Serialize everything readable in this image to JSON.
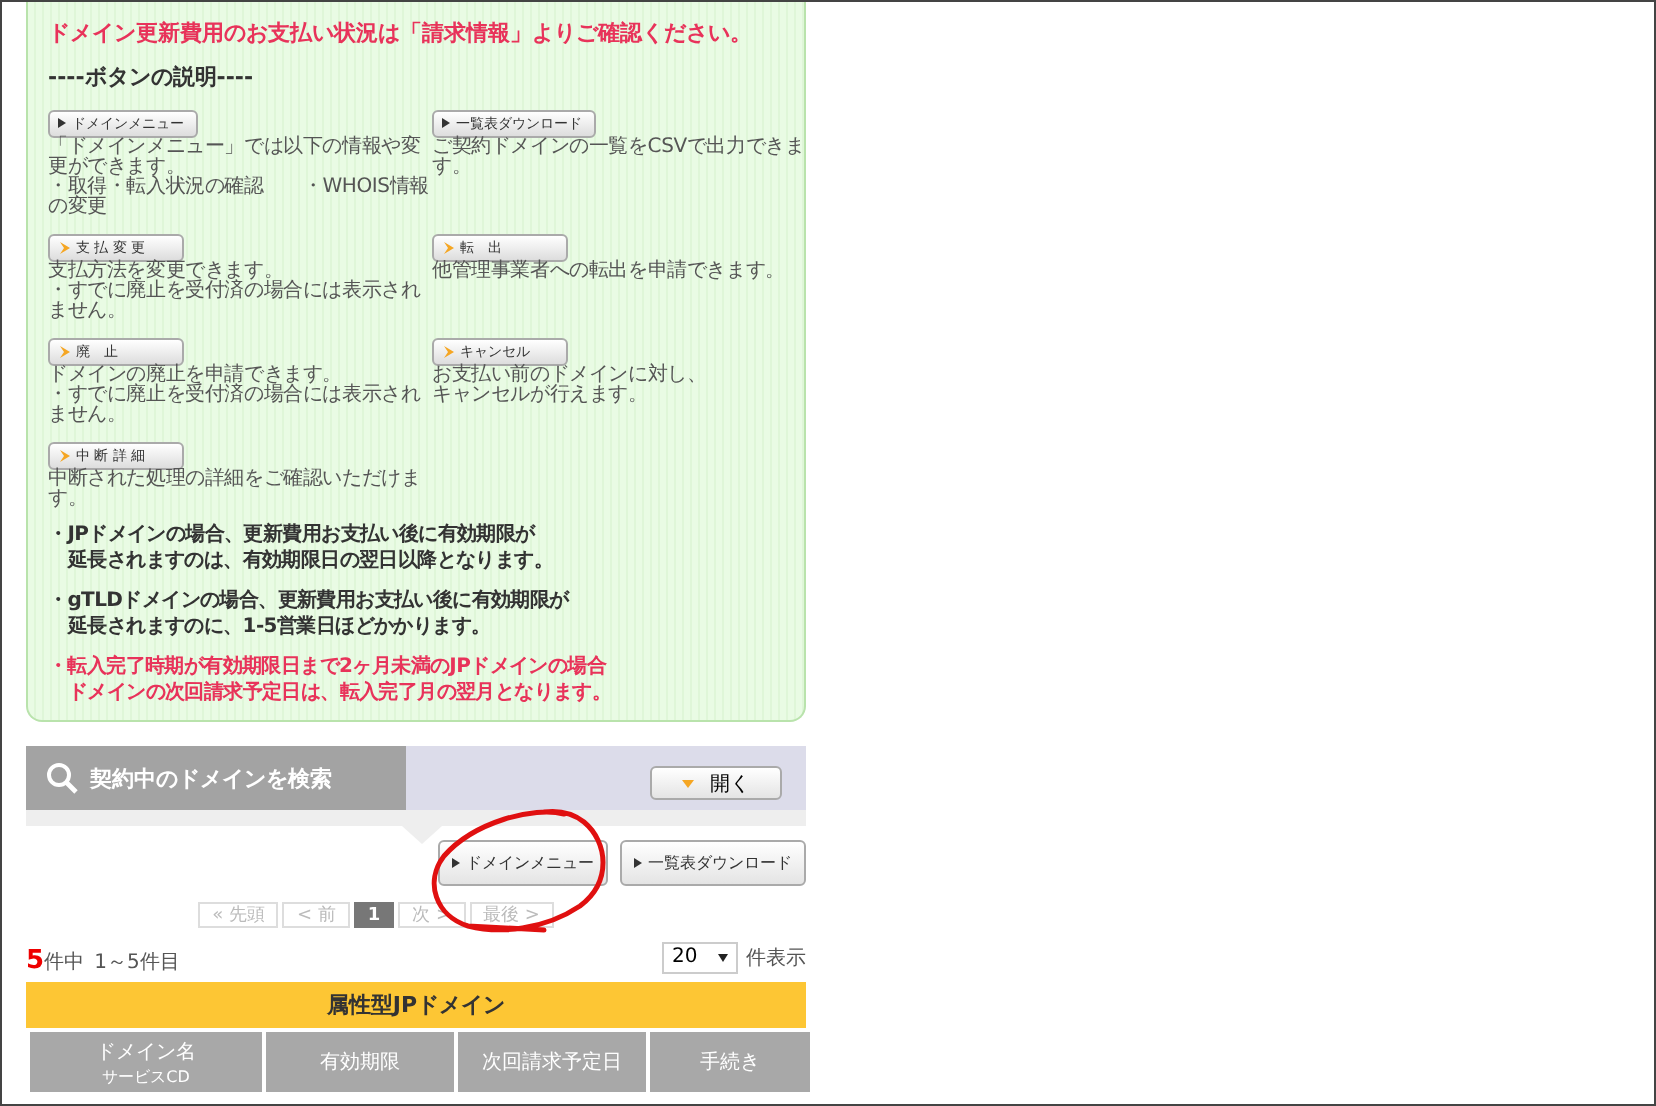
{
  "notice": {
    "heading": "ドメイン更新費用のお支払い状況は「請求情報」よりご確認ください。",
    "guide_title": "----ボタンの説明----",
    "buttons": [
      {
        "kind": "menu",
        "label": "ドメインメニュー",
        "lines": [
          "「ドメインメニュー」では以下の情報や変更ができます。",
          "・取得・転入状況の確認　　・WHOIS情報の変更"
        ]
      },
      {
        "kind": "menu",
        "label": "一覧表ダウンロード",
        "lines": [
          "ご契約ドメインの一覧をCSVで出力できます。"
        ]
      },
      {
        "kind": "action",
        "label": "支 払 変 更",
        "lines": [
          "支払方法を変更できます。",
          "・すでに廃止を受付済の場合には表示されません。"
        ]
      },
      {
        "kind": "action",
        "label": "転　出",
        "lines": [
          "他管理事業者への転出を申請できます。"
        ]
      },
      {
        "kind": "action",
        "label": "廃　止",
        "lines": [
          "ドメインの廃止を申請できます。",
          "・すでに廃止を受付済の場合には表示されません。"
        ]
      },
      {
        "kind": "action",
        "label": "キャンセル",
        "lines": [
          "お支払い前のドメインに対し、",
          "キャンセルが行えます。"
        ]
      },
      {
        "kind": "action",
        "label": "中 断 詳 細",
        "lines": [
          "中断された処理の詳細をご確認いただけます。"
        ]
      }
    ],
    "notes": [
      {
        "kind": "normal",
        "lines": [
          "・JPドメインの場合、更新費用お支払い後に有効期限が",
          "延長されますのは、有効期限日の翌日以降となります。"
        ]
      },
      {
        "kind": "normal",
        "lines": [
          "・gTLDドメインの場合、更新費用お支払い後に有効期限が",
          "延長されますのに、1-5営業日ほどかかります。"
        ]
      },
      {
        "kind": "alert",
        "lines": [
          "・転入完了時期が有効期限日まで2ヶ月未満のJPドメインの場合",
          "ドメインの次回請求予定日は、転入完了月の翌月となります。"
        ]
      }
    ]
  },
  "search": {
    "title": "契約中のドメインを検索",
    "toggle": "開く"
  },
  "actions": [
    "ドメインメニュー",
    "一覧表ダウンロード"
  ],
  "pagination": [
    {
      "label": "« 先頭",
      "selected": false
    },
    {
      "label": "< 前",
      "selected": false
    },
    {
      "label": "1",
      "selected": true
    },
    {
      "label": "次 >",
      "selected": false
    },
    {
      "label": "最後 >",
      "selected": false
    }
  ],
  "count": {
    "total": "5",
    "total_suffix": "件中",
    "range": "1～5件目",
    "per_page": "20",
    "per_page_suffix": "件表示"
  },
  "table": {
    "title": "属性型JPドメイン",
    "columns": [
      {
        "label": "ドメイン名",
        "sub": "サービスCD"
      },
      {
        "label": "有効期限"
      },
      {
        "label": "次回請求予定日"
      },
      {
        "label": "手続き"
      }
    ]
  }
}
